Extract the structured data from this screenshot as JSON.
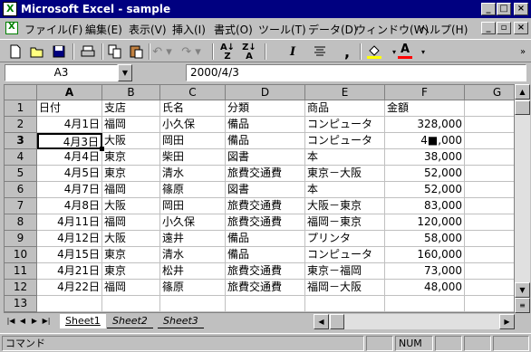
{
  "window": {
    "title": "Microsoft Excel - sample"
  },
  "menu": {
    "items": [
      "ファイル(F)",
      "編集(E)",
      "表示(V)",
      "挿入(I)",
      "書式(O)",
      "ツール(T)",
      "データ(D)",
      "ウィンドウ(W)",
      "ヘルプ(H)"
    ]
  },
  "toolbar": {
    "buttons": [
      "new-icon",
      "open-icon",
      "save-icon",
      "print-icon",
      "copy-icon",
      "paste-icon",
      "undo-icon",
      "redo-icon",
      "sort-ascending-icon",
      "sort-descending-icon",
      "italic-icon",
      "align-center-icon",
      "comma-style-icon",
      "fill-color-icon",
      "font-color-icon"
    ],
    "italic_label": "I",
    "comma_label": ","
  },
  "formula_bar": {
    "name_box": "A3",
    "formula": "2000/4/3"
  },
  "grid": {
    "columns": [
      "A",
      "B",
      "C",
      "D",
      "E",
      "F",
      "G"
    ],
    "rows": [
      "1",
      "2",
      "3",
      "4",
      "5",
      "6",
      "7",
      "8",
      "9",
      "10",
      "11",
      "12",
      "13"
    ],
    "data": [
      [
        "日付",
        "支店",
        "氏名",
        "分類",
        "商品",
        "金額",
        ""
      ],
      [
        "4月1日",
        "福岡",
        "小久保",
        "備品",
        "コンピュータ",
        "328,000",
        ""
      ],
      [
        "4月3日",
        "大阪",
        "岡田",
        "備品",
        "コンピュータ",
        "4■,000",
        ""
      ],
      [
        "4月4日",
        "東京",
        "柴田",
        "図書",
        "本",
        "38,000",
        ""
      ],
      [
        "4月5日",
        "東京",
        "清水",
        "旅費交通費",
        "東京－大阪",
        "52,000",
        ""
      ],
      [
        "4月7日",
        "福岡",
        "篠原",
        "図書",
        "本",
        "52,000",
        ""
      ],
      [
        "4月8日",
        "大阪",
        "岡田",
        "旅費交通費",
        "大阪－東京",
        "83,000",
        ""
      ],
      [
        "4月11日",
        "福岡",
        "小久保",
        "旅費交通費",
        "福岡－東京",
        "120,000",
        ""
      ],
      [
        "4月12日",
        "大阪",
        "遠井",
        "備品",
        "プリンタ",
        "58,000",
        ""
      ],
      [
        "4月15日",
        "東京",
        "清水",
        "備品",
        "コンピュータ",
        "160,000",
        ""
      ],
      [
        "4月21日",
        "東京",
        "松井",
        "旅費交通費",
        "東京－福岡",
        "73,000",
        ""
      ],
      [
        "4月22日",
        "福岡",
        "篠原",
        "旅費交通費",
        "福岡－大阪",
        "48,000",
        ""
      ],
      [
        "",
        "",
        "",
        "",
        "",
        "",
        ""
      ]
    ],
    "active_cell": "A3"
  },
  "sheets": [
    "Sheet1",
    "Sheet2",
    "Sheet3"
  ],
  "status": {
    "mode": "コマンド",
    "num": "NUM"
  }
}
